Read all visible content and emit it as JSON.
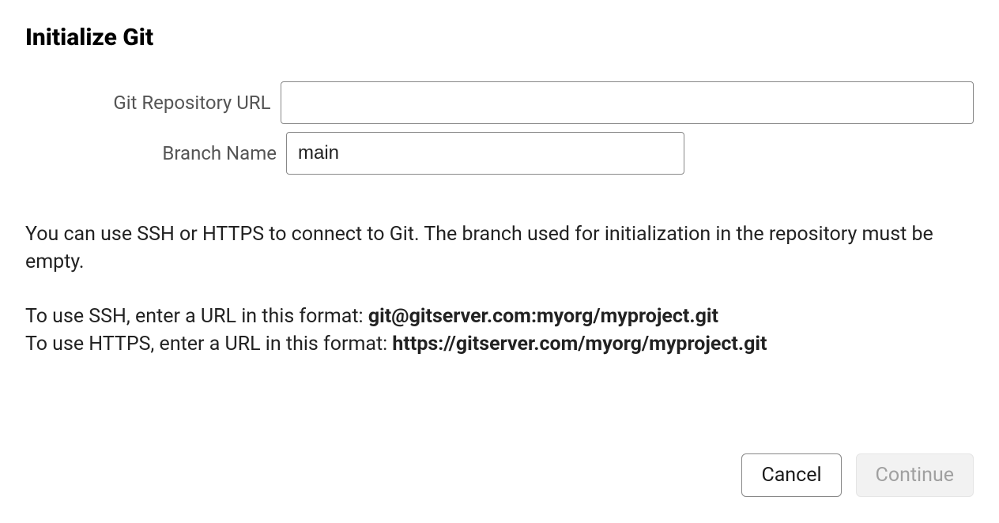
{
  "title": "Initialize Git",
  "form": {
    "url_label": "Git Repository URL",
    "url_value": "",
    "branch_label": "Branch Name",
    "branch_value": "main"
  },
  "help": {
    "intro": "You can use SSH or HTTPS to connect to Git. The branch used for initialization in the repository must be empty.",
    "ssh_prefix": "To use SSH, enter a URL in this format: ",
    "ssh_example": "git@gitserver.com:myorg/myproject.git",
    "https_prefix": "To use HTTPS, enter a URL in this format: ",
    "https_example": "https://gitserver.com/myorg/myproject.git"
  },
  "buttons": {
    "cancel": "Cancel",
    "continue": "Continue"
  }
}
